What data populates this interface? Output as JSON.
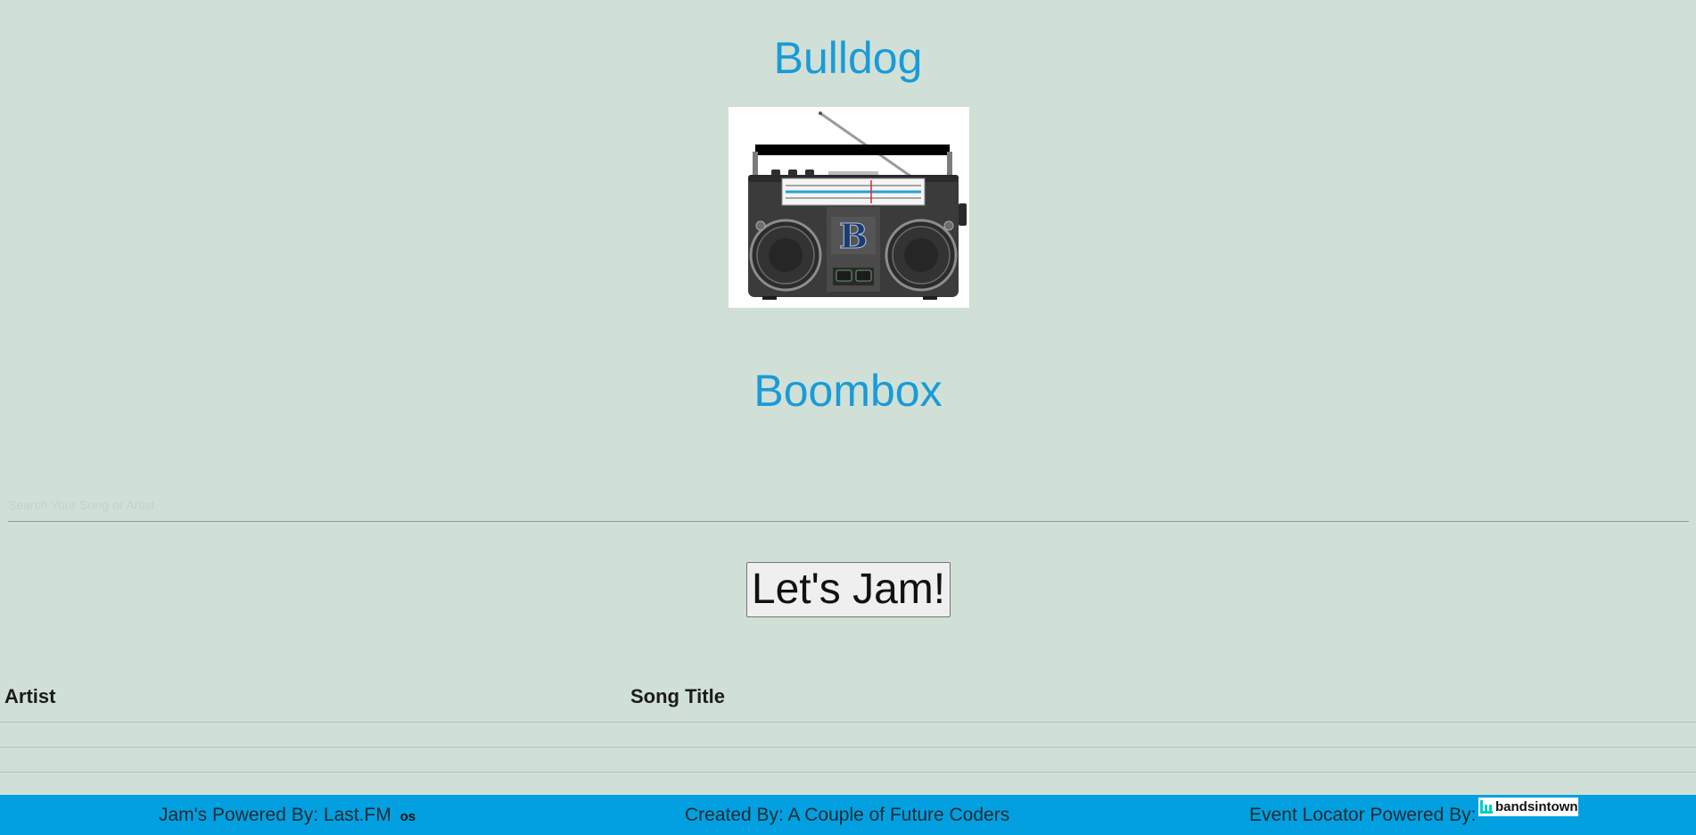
{
  "header": {
    "title": "Bulldog",
    "subtitle": "Boombox"
  },
  "logo": {
    "icon": "boombox-b-logo-icon",
    "letter": "B"
  },
  "search": {
    "placeholder": "Search Your Song or Artist",
    "value": ""
  },
  "jam_button": {
    "label": "Let's Jam!"
  },
  "results": {
    "columns": [
      "Artist",
      "Song Title"
    ],
    "rows": []
  },
  "footer": {
    "left": "Jam's Powered By: Last.FM",
    "lastfm_icon": "lastfm-icon",
    "lastfm_glyph": "os",
    "center": "Created By: A Couple of Future Coders",
    "right": "Event Locator Powered By:",
    "bandsintown_logo": "bandsintown"
  },
  "colors": {
    "background": "#d0e0d7",
    "accent": "#1a9bd7",
    "footer": "#02a0e0"
  }
}
